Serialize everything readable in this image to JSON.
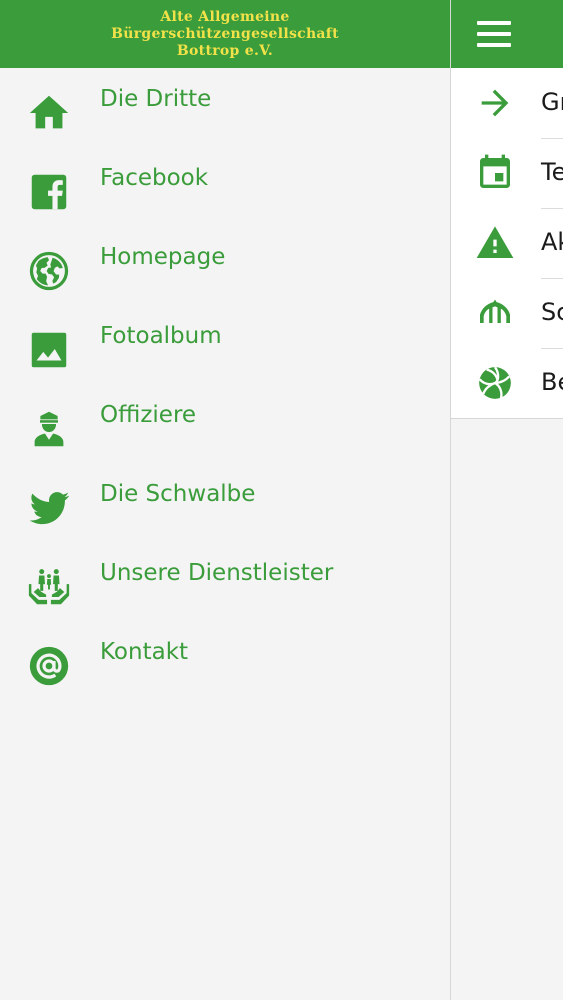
{
  "app": {
    "logo_lines": [
      "Alte Allgemeine",
      "Bürgerschützengesellschaft",
      "Bottrop e.V."
    ],
    "accent_color": "#3a9c3a",
    "logo_color": "#f2e24a"
  },
  "drawer": {
    "items": [
      {
        "label": "Die Dritte",
        "icon": "home-icon"
      },
      {
        "label": "Facebook",
        "icon": "facebook-icon"
      },
      {
        "label": "Homepage",
        "icon": "globe-icon"
      },
      {
        "label": "Fotoalbum",
        "icon": "photo-icon"
      },
      {
        "label": "Offiziere",
        "icon": "officer-icon"
      },
      {
        "label": "Die Schwalbe",
        "icon": "bird-icon"
      },
      {
        "label": "Unsere Dienstleister",
        "icon": "family-hands-icon"
      },
      {
        "label": "Kontakt",
        "icon": "at-sign-icon"
      }
    ]
  },
  "main": {
    "menu_icon": "hamburger-icon",
    "list": [
      {
        "text": "Gr",
        "icon": "arrow-right-icon"
      },
      {
        "text": "Te",
        "icon": "calendar-icon"
      },
      {
        "text": "Ak",
        "icon": "warning-icon"
      },
      {
        "text": "Sc",
        "icon": "tent-icon"
      },
      {
        "text": "Be",
        "icon": "volleyball-icon"
      }
    ]
  }
}
